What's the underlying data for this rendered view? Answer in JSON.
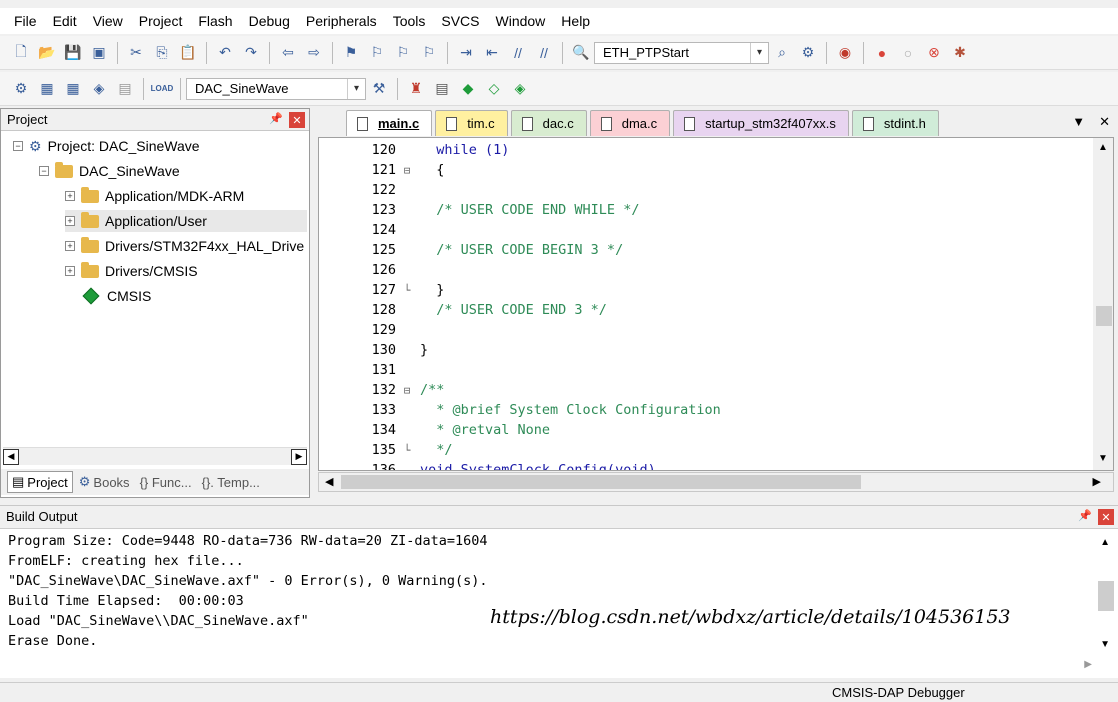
{
  "menu": [
    "File",
    "Edit",
    "View",
    "Project",
    "Flash",
    "Debug",
    "Peripherals",
    "Tools",
    "SVCS",
    "Window",
    "Help"
  ],
  "toolbar1": {
    "find_combo": "ETH_PTPStart"
  },
  "toolbar2": {
    "target_combo": "DAC_SineWave",
    "load_label": "LOAD"
  },
  "project_pane": {
    "title": "Project",
    "root": "Project: DAC_SineWave",
    "target": "DAC_SineWave",
    "items": [
      "Application/MDK-ARM",
      "Application/User",
      "Drivers/STM32F4xx_HAL_Drive",
      "Drivers/CMSIS",
      "CMSIS"
    ],
    "bottom_tabs": [
      "Project",
      "Books",
      "{} Func...",
      "{}. Temp..."
    ]
  },
  "editor_tabs": [
    {
      "label": "main.c",
      "color": "#ffffff",
      "active": true
    },
    {
      "label": "tim.c",
      "color": "#fff0a0"
    },
    {
      "label": "dac.c",
      "color": "#d8ecd0"
    },
    {
      "label": "dma.c",
      "color": "#fbd0d4"
    },
    {
      "label": "startup_stm32f407xx.s",
      "color": "#e8d4f0"
    },
    {
      "label": "stdint.h",
      "color": "#d0ecd8"
    }
  ],
  "code_lines": [
    {
      "num": "120",
      "fold": "",
      "text": "  while (1)"
    },
    {
      "num": "121",
      "fold": "⊟",
      "text": "  {"
    },
    {
      "num": "122",
      "fold": "",
      "text": ""
    },
    {
      "num": "123",
      "fold": "",
      "text": "  /* USER CODE END WHILE */"
    },
    {
      "num": "124",
      "fold": "",
      "text": ""
    },
    {
      "num": "125",
      "fold": "",
      "text": "  /* USER CODE BEGIN 3 */"
    },
    {
      "num": "126",
      "fold": "",
      "text": ""
    },
    {
      "num": "127",
      "fold": "└",
      "text": "  }"
    },
    {
      "num": "128",
      "fold": "",
      "text": "  /* USER CODE END 3 */"
    },
    {
      "num": "129",
      "fold": "",
      "text": ""
    },
    {
      "num": "130",
      "fold": "",
      "text": "}"
    },
    {
      "num": "131",
      "fold": "",
      "text": ""
    },
    {
      "num": "132",
      "fold": "⊟",
      "text": "/**"
    },
    {
      "num": "133",
      "fold": "",
      "text": "  * @brief System Clock Configuration"
    },
    {
      "num": "134",
      "fold": "",
      "text": "  * @retval None"
    },
    {
      "num": "135",
      "fold": "└",
      "text": "  */"
    },
    {
      "num": "136",
      "fold": "",
      "text": "void SystemClock_Config(void)"
    }
  ],
  "build_output": {
    "title": "Build Output",
    "lines": [
      "Program Size: Code=9448 RO-data=736 RW-data=20 ZI-data=1604",
      "FromELF: creating hex file...",
      "\"DAC_SineWave\\DAC_SineWave.axf\" - 0 Error(s), 0 Warning(s).",
      "Build Time Elapsed:  00:00:03",
      "Load \"DAC_SineWave\\\\DAC_SineWave.axf\"",
      "Erase Done."
    ],
    "watermark": "https://blog.csdn.net/wbdxz/article/details/104536153"
  },
  "status": {
    "debugger": "CMSIS-DAP Debugger"
  },
  "colors": {
    "comment": "#2e8b57",
    "keyword": "#1a1aa6",
    "close": "#d9443a"
  }
}
